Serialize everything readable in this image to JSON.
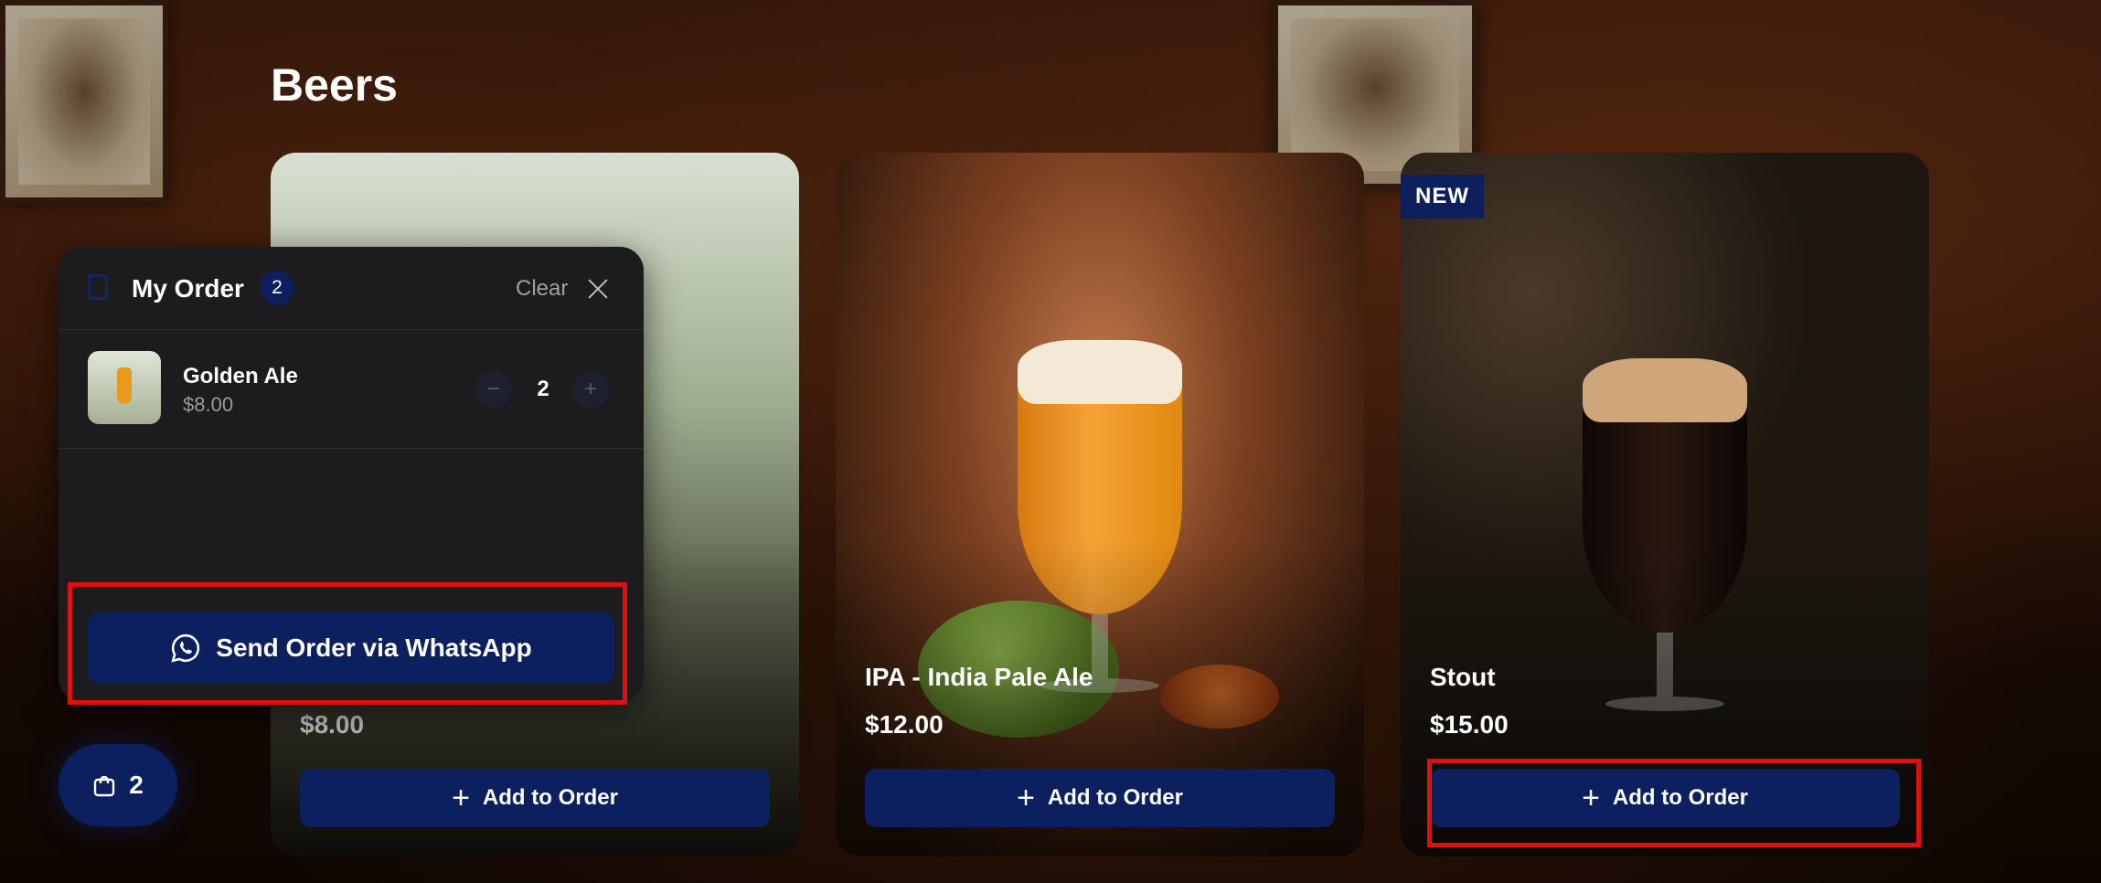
{
  "section": {
    "title": "Beers"
  },
  "products": [
    {
      "name": "",
      "price": "$8.00",
      "add_label": "Add to Order"
    },
    {
      "name": "IPA - India Pale Ale",
      "price": "$12.00",
      "add_label": "Add to Order"
    },
    {
      "name": "Stout",
      "price": "$15.00",
      "add_label": "Add to Order",
      "badge": "NEW"
    }
  ],
  "order": {
    "title": "My Order",
    "count": "2",
    "clear_label": "Clear",
    "items": [
      {
        "name": "Golden Ale",
        "price": "$8.00",
        "quantity": "2",
        "minus": "−",
        "plus": "+"
      }
    ],
    "send_label": "Send Order via WhatsApp"
  },
  "cart_fab": {
    "count": "2"
  },
  "colors": {
    "primary": "#0c1f5e",
    "panel": "#1c1c1e",
    "highlight": "#e01010"
  },
  "icons": {
    "close": "close-icon",
    "bag": "shopping-bag-icon",
    "whatsapp": "whatsapp-icon",
    "plus": "plus-icon"
  }
}
